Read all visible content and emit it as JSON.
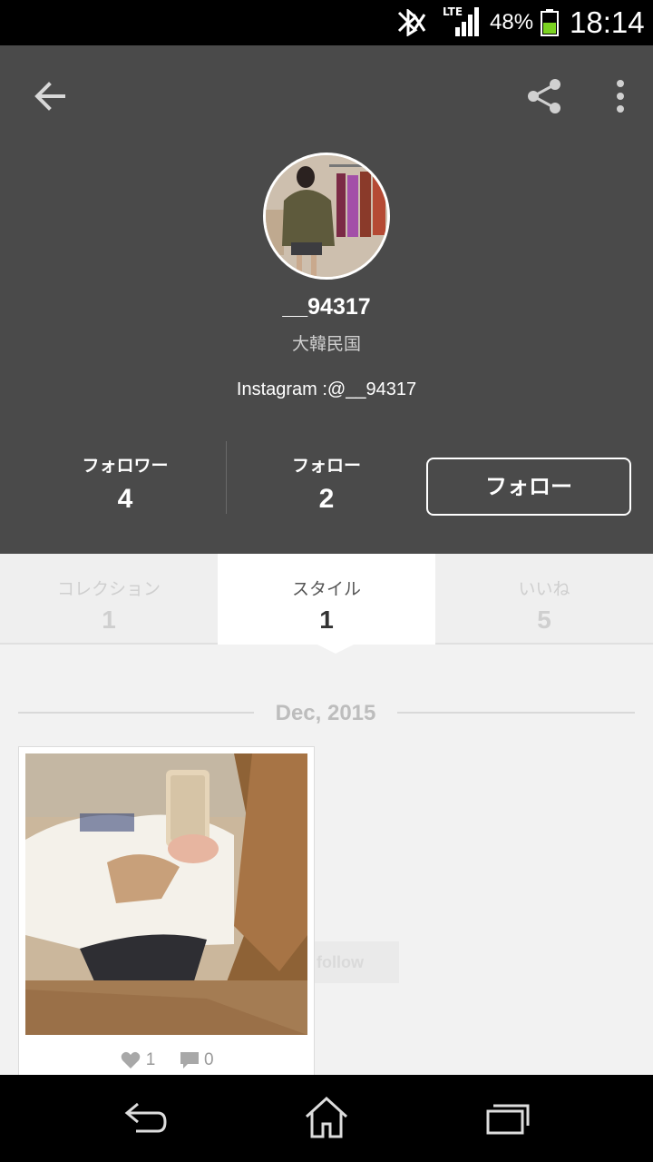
{
  "status_bar": {
    "battery_percent": "48%",
    "time": "18:14",
    "network": "LTE"
  },
  "header": {
    "username": "__94317",
    "country": "大韓民国",
    "bio": "Instagram :@__94317",
    "stats": [
      {
        "label": "フォロワー",
        "value": "4"
      },
      {
        "label": "フォロー",
        "value": "2"
      }
    ],
    "follow_button": "フォロー"
  },
  "tabs": [
    {
      "label": "コレクション",
      "count": "1",
      "active": false
    },
    {
      "label": "スタイル",
      "count": "1",
      "active": true
    },
    {
      "label": "いいね",
      "count": "5",
      "active": false
    }
  ],
  "timeline": {
    "date": "Dec, 2015",
    "posts": [
      {
        "likes": "1",
        "comments": "0"
      }
    ],
    "ghost_button": "follow"
  },
  "colors": {
    "header_bg": "#4a4a4a",
    "page_bg": "#f2f2f2",
    "statusbar_bg": "#000000"
  },
  "icons": [
    "back-arrow-icon",
    "share-icon",
    "more-vert-icon",
    "heart-icon",
    "comment-icon",
    "nav-back-icon",
    "nav-home-icon",
    "nav-recents-icon"
  ]
}
